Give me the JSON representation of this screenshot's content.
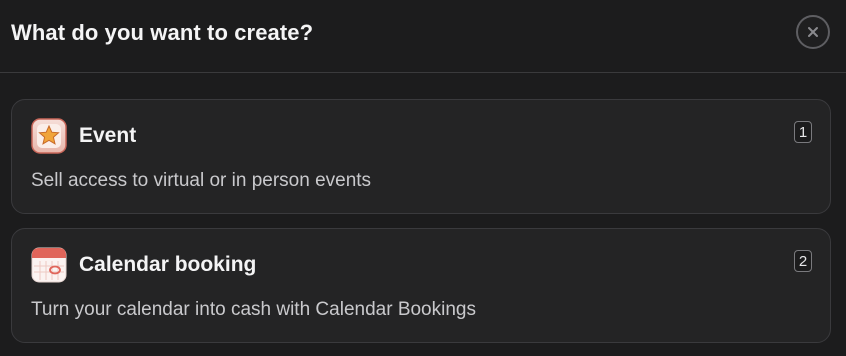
{
  "dialog": {
    "title": "What do you want to create?",
    "close_icon": "close-icon"
  },
  "options": [
    {
      "title": "Event",
      "description": "Sell access to virtual or in person events",
      "shortcut": "1",
      "icon": "star-icon"
    },
    {
      "title": "Calendar booking",
      "description": "Turn your calendar into cash with Calendar Bookings",
      "shortcut": "2",
      "icon": "calendar-icon"
    }
  ],
  "colors": {
    "background": "#1c1c1d",
    "card_background": "#242425",
    "border": "#3a3a3d",
    "icon_red": "#e0655a"
  }
}
